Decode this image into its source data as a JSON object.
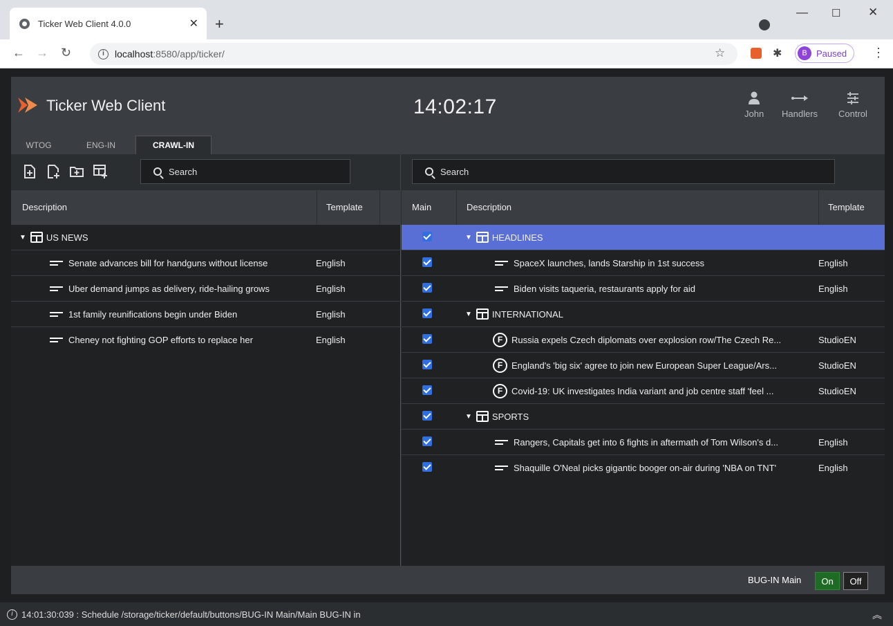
{
  "browser": {
    "tab_title": "Ticker Web Client 4.0.0",
    "url_host": "localhost",
    "url_path": ":8580/app/ticker/",
    "profile_initial": "B",
    "profile_status": "Paused"
  },
  "app": {
    "title": "Ticker Web Client",
    "clock": "14:02:17",
    "header_buttons": [
      {
        "label": "John",
        "icon": "user-icon"
      },
      {
        "label": "Handlers",
        "icon": "arrow-right-icon"
      },
      {
        "label": "Control",
        "icon": "sliders-icon"
      }
    ],
    "tabs": [
      "WTOG",
      "ENG-IN",
      "CRAWL-IN"
    ],
    "active_tab": "CRAWL-IN"
  },
  "left": {
    "search_label": "Search",
    "columns": {
      "description": "Description",
      "template": "Template"
    },
    "group": "US NEWS",
    "items": [
      {
        "text": "Senate advances bill for handguns without license",
        "template": "English"
      },
      {
        "text": "Uber demand jumps as delivery, ride-hailing grows",
        "template": "English"
      },
      {
        "text": "1st family reunifications begin under Biden",
        "template": "English"
      },
      {
        "text": "Cheney not fighting GOP efforts to replace her",
        "template": "English"
      }
    ]
  },
  "right": {
    "search_label": "Search",
    "columns": {
      "main": "Main",
      "description": "Description",
      "template": "Template"
    },
    "rows": [
      {
        "type": "group",
        "text": "HEADLINES",
        "selected": true
      },
      {
        "type": "text",
        "text": "SpaceX launches, lands Starship in 1st success",
        "template": "English"
      },
      {
        "type": "text",
        "text": "Biden visits taqueria, restaurants apply for aid",
        "template": "English"
      },
      {
        "type": "group",
        "text": "INTERNATIONAL"
      },
      {
        "type": "feed",
        "text": "Russia expels Czech diplomats over explosion row/The Czech Re...",
        "template": "StudioEN"
      },
      {
        "type": "feed",
        "text": "England's 'big six' agree to join new European Super League/Ars...",
        "template": "StudioEN"
      },
      {
        "type": "feed",
        "text": "Covid-19: UK investigates India variant and job centre staff 'feel ...",
        "template": "StudioEN"
      },
      {
        "type": "group",
        "text": "SPORTS"
      },
      {
        "type": "text",
        "text": "Rangers, Capitals get into 6 fights in aftermath of Tom Wilson's d...",
        "template": "English"
      },
      {
        "type": "text",
        "text": "Shaquille O'Neal picks gigantic booger on-air during 'NBA on TNT'",
        "template": "English"
      }
    ]
  },
  "footer": {
    "bug_label": "BUG-IN Main",
    "on": "On",
    "off": "Off"
  },
  "status": {
    "message": "14:01:30:039 : Schedule /storage/ticker/default/buttons/BUG-IN Main/Main BUG-IN in"
  }
}
